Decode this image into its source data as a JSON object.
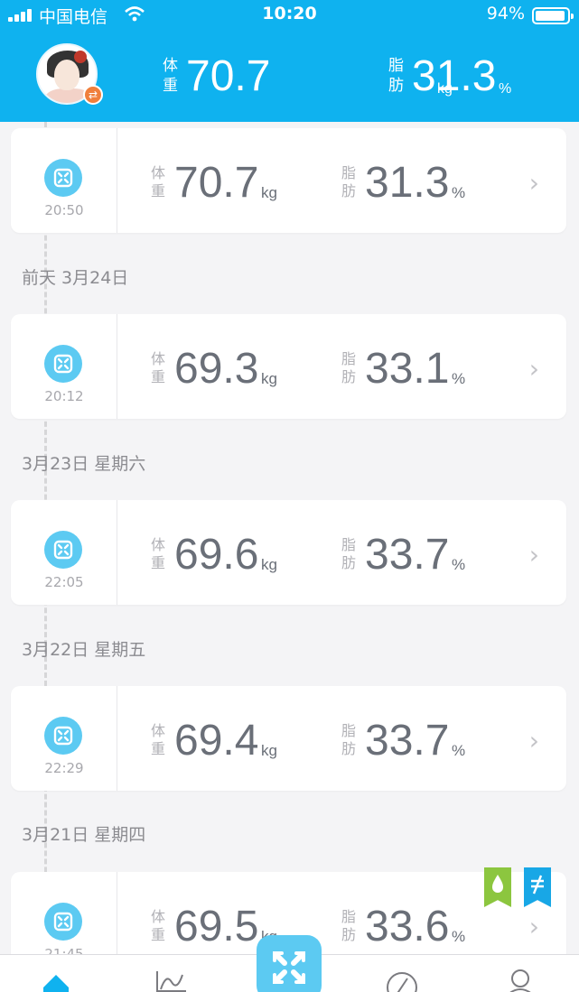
{
  "status_bar": {
    "carrier": "中国电信",
    "time": "10:20",
    "battery": "94%",
    "battery_level": 0.94
  },
  "header": {
    "weight_label": "体重",
    "weight_value": "70.7",
    "weight_unit": "kg",
    "fat_label": "脂肪",
    "fat_value": "31.3",
    "fat_unit": "%",
    "avatar_icon": "user-avatar",
    "switch_icon": "swap-icon"
  },
  "records": [
    {
      "time": "20:50",
      "weight": "70.7",
      "fat": "31.3"
    },
    {
      "date": "前天 3月24日",
      "time": "20:12",
      "weight": "69.3",
      "fat": "33.1"
    },
    {
      "date": "3月23日 星期六",
      "time": "22:05",
      "weight": "69.6",
      "fat": "33.7"
    },
    {
      "date": "3月22日 星期五",
      "time": "22:29",
      "weight": "69.4",
      "fat": "33.7"
    },
    {
      "date": "3月21日 星期四",
      "time": "21:45",
      "weight": "69.5",
      "fat": "33.6"
    }
  ],
  "labels": {
    "weight": "体重",
    "fat": "脂肪",
    "kg": "kg",
    "percent": "%"
  },
  "badges": {
    "water_icon": "water-drop-icon",
    "energy_icon": "lightning-icon",
    "water_color": "#8cc63f",
    "energy_color": "#18a7e6"
  },
  "tabbar": {
    "items": [
      "home-icon",
      "trend-icon",
      "scale-icon",
      "discover-icon",
      "profile-icon"
    ],
    "active": "home-icon",
    "accent": "#0fb2ef"
  }
}
